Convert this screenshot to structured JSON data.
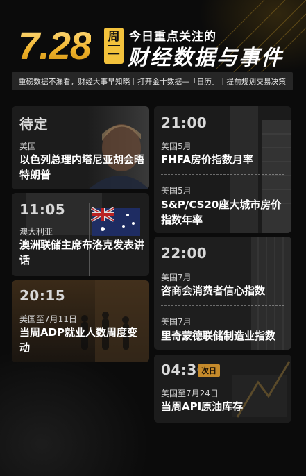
{
  "header": {
    "date": "7.28",
    "weekday_top": "周",
    "weekday_bottom": "一",
    "title_small": "今日重点关注的",
    "title_big": "财经数据与事件"
  },
  "subtitle": "重磅数据不漏看，财经大事早知晓｜打开金十数据—「日历」｜提前规划交易决策",
  "colors": {
    "accent": "#f3c23c",
    "background": "#0b0b0b",
    "card": "#1e1e1e",
    "badge": "#c58a2b"
  },
  "left_column": [
    {
      "time": "待定",
      "region": "美国",
      "event": "以色列总理内塔尼亚胡会晤特朗普"
    },
    {
      "time": "11:05",
      "region": "澳大利亚",
      "event": "澳洲联储主席布洛克发表讲话"
    },
    {
      "time": "20:15",
      "region": "美国至7月11日",
      "event": "当周ADP就业人数周度变动"
    }
  ],
  "right_column": [
    {
      "time": "21:00",
      "items": [
        {
          "region": "美国5月",
          "event": "FHFA房价指数月率"
        },
        {
          "region": "美国5月",
          "event": "S&P/CS20座大城市房价指数年率"
        }
      ]
    },
    {
      "time": "22:00",
      "items": [
        {
          "region": "美国7月",
          "event": "咨商会消费者信心指数"
        },
        {
          "region": "美国7月",
          "event": "里奇蒙德联储制造业指数"
        }
      ]
    },
    {
      "time": "04:30",
      "badge": "次日",
      "items": [
        {
          "region": "美国至7月24日",
          "event": "当周API原油库存"
        }
      ]
    }
  ]
}
